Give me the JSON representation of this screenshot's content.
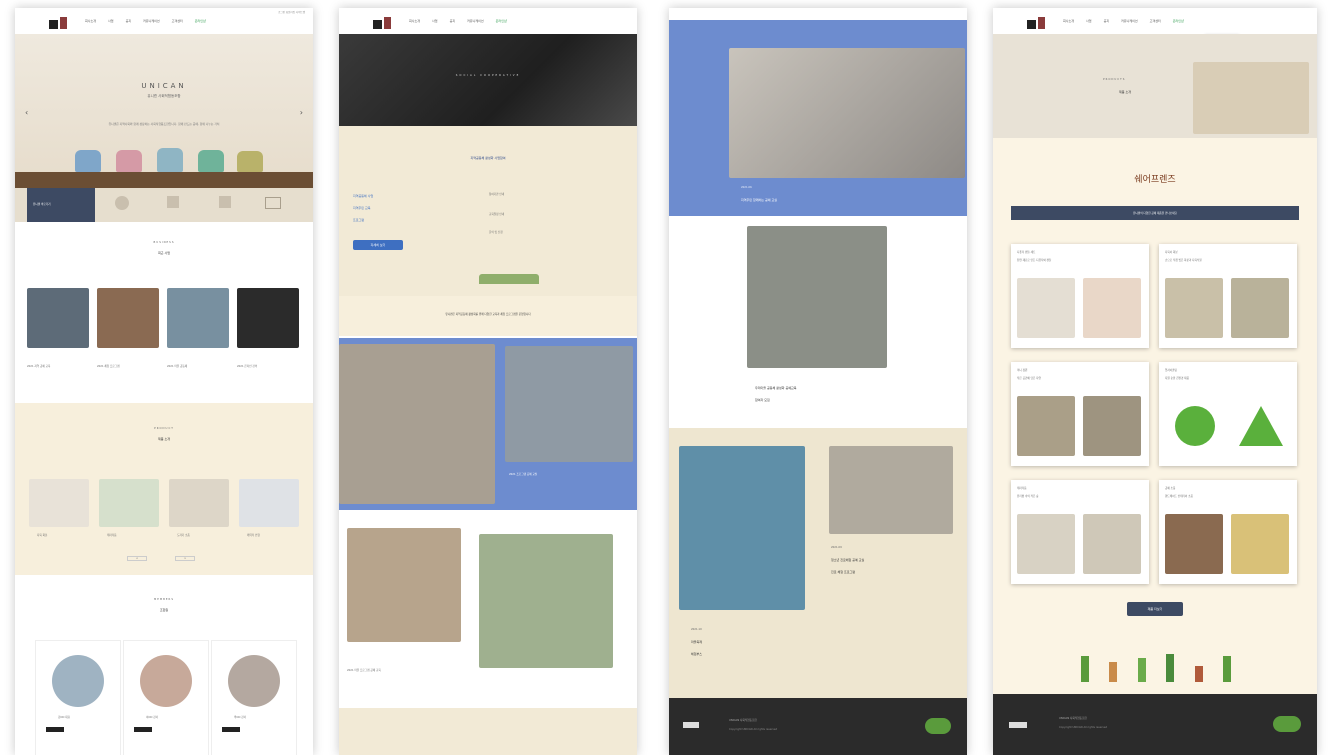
{
  "panel1": {
    "nav": {
      "items": [
        "회사소개",
        "사업",
        "공지",
        "커뮤니케이션",
        "고객센터",
        "온라인샵"
      ],
      "util": "로그인 회원가입 사이트맵"
    },
    "hero": {
      "title": "UNICAN",
      "subtitle": "유니캔 사회적협동조합",
      "desc": "유니캔은 지역사회와 함께 성장하는 사회적협동조합입니다. 함께 만드는 공예, 함께 나누는 가치"
    },
    "quicklinks": [
      "유니캔 바로가기",
      "교육",
      "체험",
      "공예",
      "문의"
    ],
    "sections": {
      "business": {
        "en": "BUSINESS",
        "ko": "최근 사업"
      },
      "product": {
        "en": "PRODUCT",
        "ko": "제품 소개"
      },
      "members": {
        "en": "MEMBERS",
        "ko": "조합원"
      }
    },
    "news": [
      "2021 지역 공예 교육",
      "2021 체험 프로그램",
      "2021 마을 공동체",
      "2021 온라인 강의"
    ],
    "products": [
      "다육 화분",
      "테라리움",
      "도자기 소품",
      "캐릭터 인형"
    ],
    "members": [
      "김OO 대표",
      "이OO 강사",
      "박OO 강사"
    ],
    "more_label": "more",
    "pagination": [
      "<",
      ">"
    ]
  },
  "panel2": {
    "hero_text": "SOCIAL COOPERATIVE",
    "intro_title": "지역공동체 활성화 사업참여",
    "links": [
      "지역공동체 사업",
      "지역주민 교육",
      "프로그램"
    ],
    "info": [
      "참여기관 안내",
      "교육일정 안내",
      "문의 및 신청"
    ],
    "cta_label": "자세히 보기",
    "notice": "유니캔은 지역공동체 활성화를 위해 다양한 교육과 체험 프로그램을 운영합니다",
    "gallery_captions": [
      "2021 프로그램 공예 교실",
      "2021 마을 프로그램 공예 교육"
    ]
  },
  "panel3": {
    "cap_top_date": "2021.06",
    "cap_top_title": "지역주민 함께하는 공예 교실",
    "cap_mid": "우리마을 공동체 활성화 공예교육",
    "cap_mid2": "참여자 모집",
    "cap_right_date": "2021.09",
    "cap_right_title": "청소년 진로체험 공예 교실",
    "cap_right_title2": "진로 체험 프로그램",
    "cap_bottom_date": "2021.10",
    "cap_bottom_title": "마을축제",
    "cap_bottom_title2": "체험부스"
  },
  "panel4": {
    "hero_title": "PRODUCTS",
    "hero_subtitle": "제품 소개",
    "brand": "쉐어프렌즈",
    "banner": "유니캔의 다양한 공예 제품을 만나보세요",
    "cards": [
      {
        "title": "디퓨저 캔들 세트",
        "desc": "천연 재료로 만든 디퓨저와 캔들"
      },
      {
        "title": "다육이 화분",
        "desc": "손으로 직접 빚은 화분과 다육식물"
      },
      {
        "title": "미니 정원",
        "desc": "작은 공간에 담은 자연"
      },
      {
        "title": "업사이클링",
        "desc": "자원 순환 친환경 제품"
      },
      {
        "title": "테라리움",
        "desc": "유리병 속의 작은 숲"
      },
      {
        "title": "공예 소품",
        "desc": "핸드메이드 인테리어 소품"
      }
    ],
    "more_btn": "제품 더보기"
  },
  "footer": {
    "line1": "UNICAN 사회적협동조합",
    "line2": "Copyright UNICAN All rights reserved",
    "badge": "인증"
  },
  "colors": {
    "cream": "#f7efdc",
    "beige": "#eee6d0",
    "periwinkle": "#6d8ccf",
    "navy": "#3d4a63",
    "footer": "#2b2b2b",
    "accent_blue": "#3e6fc1"
  }
}
